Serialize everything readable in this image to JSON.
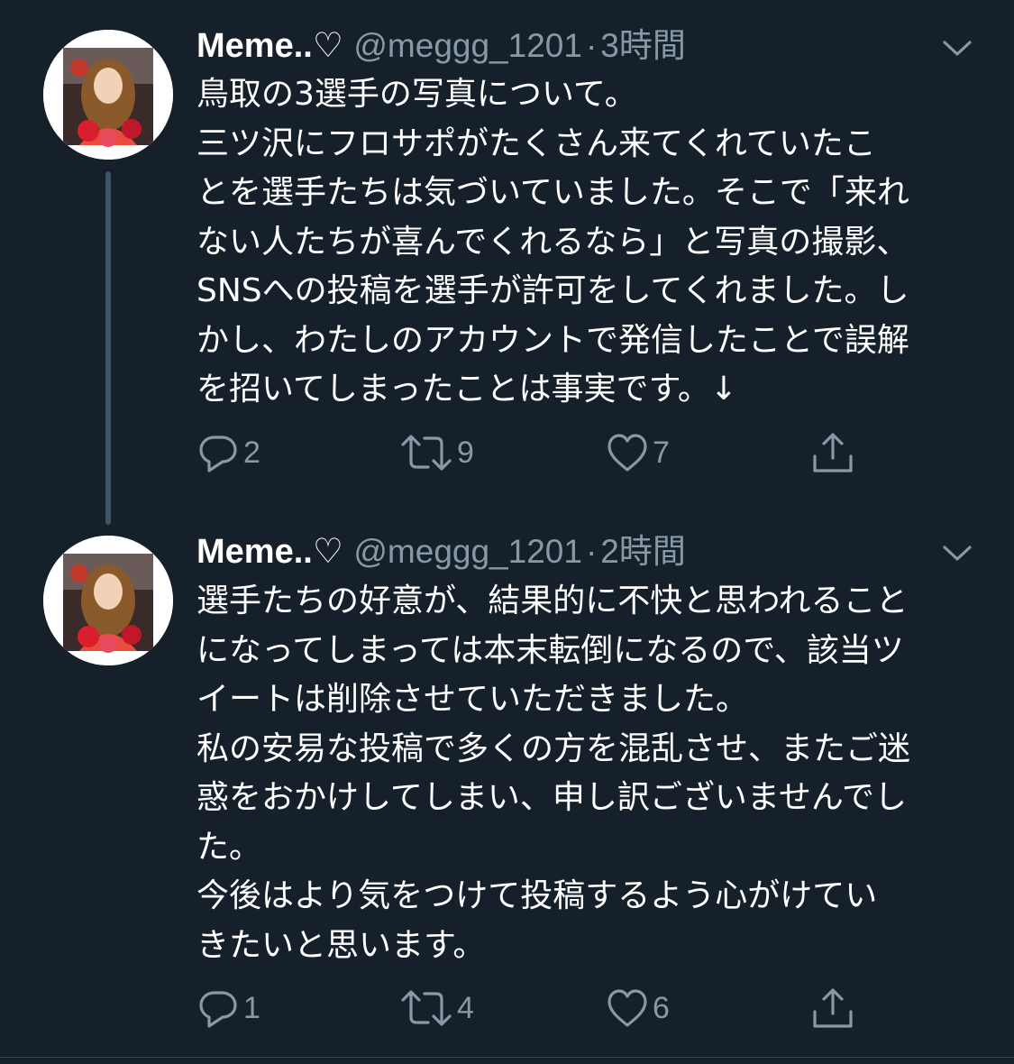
{
  "colors": {
    "background": "#15202b",
    "primary_text": "#ffffff",
    "secondary_text": "#8899a6",
    "thread_line": "#3d5466"
  },
  "tweets": [
    {
      "display_name": "Meme..♡",
      "handle": "@meggg_1201",
      "separator": "·",
      "time": "3時間",
      "text": "鳥取の3選手の写真について。\n三ツ沢にフロサポがたくさん来てくれていたこ\nとを選手たちは気づいていました。そこで「来れ\nない人たちが喜んでくれるなら」と写真の撮影、\nSNSへの投稿を選手が許可をしてくれました。し\nかし、わたしのアカウントで発信したことで誤解\nを招いてしまったことは事実です。↓",
      "reply_count": "2",
      "retweet_count": "9",
      "like_count": "7"
    },
    {
      "display_name": "Meme..♡",
      "handle": "@meggg_1201",
      "separator": "·",
      "time": "2時間",
      "text": "選手たちの好意が、結果的に不快と思われること\nになってしまっては本末転倒になるので、該当ツ\nイートは削除させていただきました。\n私の安易な投稿で多くの方を混乱させ、またご迷\n惑をおかけしてしまい、申し訳ございませんでし\nた。\n今後はより気をつけて投稿するよう心がけてい\nきたいと思います。",
      "reply_count": "1",
      "retweet_count": "4",
      "like_count": "6"
    }
  ],
  "icons": {
    "reply": "reply-icon",
    "retweet": "retweet-icon",
    "like": "heart-icon",
    "share": "share-icon",
    "menu": "chevron-down-icon"
  }
}
